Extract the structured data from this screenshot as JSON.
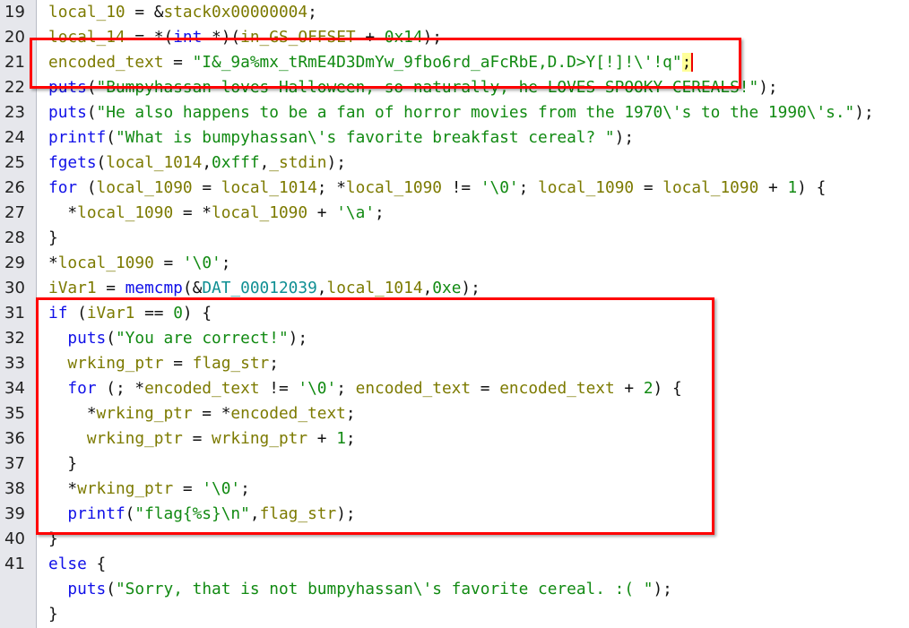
{
  "highlight_color": "#ff0000",
  "lines": [
    {
      "num": "19",
      "tokens": [
        {
          "c": "v",
          "t": "local_10"
        },
        {
          "c": "p",
          "t": " = &"
        },
        {
          "c": "v",
          "t": "stack0x00000004"
        },
        {
          "c": "p",
          "t": ";"
        }
      ]
    },
    {
      "num": "20",
      "tokens": [
        {
          "c": "v",
          "t": "local_14"
        },
        {
          "c": "p",
          "t": " = *("
        },
        {
          "c": "k",
          "t": "int"
        },
        {
          "c": "p",
          "t": " *)("
        },
        {
          "c": "v",
          "t": "in_GS_OFFSET"
        },
        {
          "c": "p",
          "t": " + "
        },
        {
          "c": "n",
          "t": "0x14"
        },
        {
          "c": "p",
          "t": ");"
        }
      ]
    },
    {
      "num": "21",
      "tokens": [
        {
          "c": "v",
          "t": "encoded_text"
        },
        {
          "c": "p",
          "t": " = "
        },
        {
          "c": "s",
          "t": "\"I&_9a%mx_tRmE4D3DmYw_9fbo6rd_aFcRbE,D.D>Y[!]!\\'!q\""
        },
        {
          "c": "h",
          "t": ";"
        }
      ]
    },
    {
      "num": "22",
      "tokens": [
        {
          "c": "f",
          "t": "puts"
        },
        {
          "c": "p",
          "t": "("
        },
        {
          "c": "s",
          "t": "\"Bumpyhassan loves Halloween, so naturally, he LOVES SPOOKY CEREALS!\""
        },
        {
          "c": "p",
          "t": ");"
        }
      ]
    },
    {
      "num": "23",
      "tokens": [
        {
          "c": "f",
          "t": "puts"
        },
        {
          "c": "p",
          "t": "("
        },
        {
          "c": "s",
          "t": "\"He also happens to be a fan of horror movies from the 1970\\'s to the 1990\\'s.\""
        },
        {
          "c": "p",
          "t": ");"
        }
      ]
    },
    {
      "num": "24",
      "tokens": [
        {
          "c": "f",
          "t": "printf"
        },
        {
          "c": "p",
          "t": "("
        },
        {
          "c": "s",
          "t": "\"What is bumpyhassan\\'s favorite breakfast cereal? \""
        },
        {
          "c": "p",
          "t": ");"
        }
      ]
    },
    {
      "num": "25",
      "tokens": [
        {
          "c": "f",
          "t": "fgets"
        },
        {
          "c": "p",
          "t": "("
        },
        {
          "c": "v",
          "t": "local_1014"
        },
        {
          "c": "p",
          "t": ","
        },
        {
          "c": "n",
          "t": "0xfff"
        },
        {
          "c": "p",
          "t": ","
        },
        {
          "c": "v",
          "t": "_stdin"
        },
        {
          "c": "p",
          "t": ");"
        }
      ]
    },
    {
      "num": "26",
      "tokens": [
        {
          "c": "k",
          "t": "for"
        },
        {
          "c": "p",
          "t": " ("
        },
        {
          "c": "v",
          "t": "local_1090"
        },
        {
          "c": "p",
          "t": " = "
        },
        {
          "c": "v",
          "t": "local_1014"
        },
        {
          "c": "p",
          "t": "; *"
        },
        {
          "c": "v",
          "t": "local_1090"
        },
        {
          "c": "p",
          "t": " != "
        },
        {
          "c": "s",
          "t": "'\\0'"
        },
        {
          "c": "p",
          "t": "; "
        },
        {
          "c": "v",
          "t": "local_1090"
        },
        {
          "c": "p",
          "t": " = "
        },
        {
          "c": "v",
          "t": "local_1090"
        },
        {
          "c": "p",
          "t": " + "
        },
        {
          "c": "n",
          "t": "1"
        },
        {
          "c": "p",
          "t": ") {"
        }
      ]
    },
    {
      "num": "27",
      "tokens": [
        {
          "c": "p",
          "t": "  *"
        },
        {
          "c": "v",
          "t": "local_1090"
        },
        {
          "c": "p",
          "t": " = *"
        },
        {
          "c": "v",
          "t": "local_1090"
        },
        {
          "c": "p",
          "t": " + "
        },
        {
          "c": "s",
          "t": "'\\a'"
        },
        {
          "c": "p",
          "t": ";"
        }
      ]
    },
    {
      "num": "28",
      "tokens": [
        {
          "c": "p",
          "t": "}"
        }
      ]
    },
    {
      "num": "29",
      "tokens": [
        {
          "c": "p",
          "t": "*"
        },
        {
          "c": "v",
          "t": "local_1090"
        },
        {
          "c": "p",
          "t": " = "
        },
        {
          "c": "s",
          "t": "'\\0'"
        },
        {
          "c": "p",
          "t": ";"
        }
      ]
    },
    {
      "num": "30",
      "tokens": [
        {
          "c": "v",
          "t": "iVar1"
        },
        {
          "c": "p",
          "t": " = "
        },
        {
          "c": "f",
          "t": "memcmp"
        },
        {
          "c": "p",
          "t": "(&"
        },
        {
          "c": "d",
          "t": "DAT_00012039"
        },
        {
          "c": "p",
          "t": ","
        },
        {
          "c": "v",
          "t": "local_1014"
        },
        {
          "c": "p",
          "t": ","
        },
        {
          "c": "n",
          "t": "0xe"
        },
        {
          "c": "p",
          "t": ");"
        }
      ]
    },
    {
      "num": "31",
      "tokens": [
        {
          "c": "k",
          "t": "if"
        },
        {
          "c": "p",
          "t": " ("
        },
        {
          "c": "v",
          "t": "iVar1"
        },
        {
          "c": "p",
          "t": " == "
        },
        {
          "c": "n",
          "t": "0"
        },
        {
          "c": "p",
          "t": ") {"
        }
      ]
    },
    {
      "num": "32",
      "tokens": [
        {
          "c": "p",
          "t": "  "
        },
        {
          "c": "f",
          "t": "puts"
        },
        {
          "c": "p",
          "t": "("
        },
        {
          "c": "s",
          "t": "\"You are correct!\""
        },
        {
          "c": "p",
          "t": ");"
        }
      ]
    },
    {
      "num": "33",
      "tokens": [
        {
          "c": "p",
          "t": "  "
        },
        {
          "c": "v",
          "t": "wrking_ptr"
        },
        {
          "c": "p",
          "t": " = "
        },
        {
          "c": "v",
          "t": "flag_str"
        },
        {
          "c": "p",
          "t": ";"
        }
      ]
    },
    {
      "num": "34",
      "tokens": [
        {
          "c": "p",
          "t": "  "
        },
        {
          "c": "k",
          "t": "for"
        },
        {
          "c": "p",
          "t": " (; *"
        },
        {
          "c": "v",
          "t": "encoded_text"
        },
        {
          "c": "p",
          "t": " != "
        },
        {
          "c": "s",
          "t": "'\\0'"
        },
        {
          "c": "p",
          "t": "; "
        },
        {
          "c": "v",
          "t": "encoded_text"
        },
        {
          "c": "p",
          "t": " = "
        },
        {
          "c": "v",
          "t": "encoded_text"
        },
        {
          "c": "p",
          "t": " + "
        },
        {
          "c": "n",
          "t": "2"
        },
        {
          "c": "p",
          "t": ") {"
        }
      ]
    },
    {
      "num": "35",
      "tokens": [
        {
          "c": "p",
          "t": "    *"
        },
        {
          "c": "v",
          "t": "wrking_ptr"
        },
        {
          "c": "p",
          "t": " = *"
        },
        {
          "c": "v",
          "t": "encoded_text"
        },
        {
          "c": "p",
          "t": ";"
        }
      ]
    },
    {
      "num": "36",
      "tokens": [
        {
          "c": "p",
          "t": "    "
        },
        {
          "c": "v",
          "t": "wrking_ptr"
        },
        {
          "c": "p",
          "t": " = "
        },
        {
          "c": "v",
          "t": "wrking_ptr"
        },
        {
          "c": "p",
          "t": " + "
        },
        {
          "c": "n",
          "t": "1"
        },
        {
          "c": "p",
          "t": ";"
        }
      ]
    },
    {
      "num": "37",
      "tokens": [
        {
          "c": "p",
          "t": "  }"
        }
      ]
    },
    {
      "num": "38",
      "tokens": [
        {
          "c": "p",
          "t": "  *"
        },
        {
          "c": "v",
          "t": "wrking_ptr"
        },
        {
          "c": "p",
          "t": " = "
        },
        {
          "c": "s",
          "t": "'\\0'"
        },
        {
          "c": "p",
          "t": ";"
        }
      ]
    },
    {
      "num": "39",
      "tokens": [
        {
          "c": "p",
          "t": "  "
        },
        {
          "c": "f",
          "t": "printf"
        },
        {
          "c": "p",
          "t": "("
        },
        {
          "c": "s",
          "t": "\"flag{%s}\\n\""
        },
        {
          "c": "p",
          "t": ","
        },
        {
          "c": "v",
          "t": "flag_str"
        },
        {
          "c": "p",
          "t": ");"
        }
      ]
    },
    {
      "num": "40",
      "tokens": [
        {
          "c": "p",
          "t": "}"
        }
      ]
    },
    {
      "num": "41",
      "tokens": [
        {
          "c": "k",
          "t": "else"
        },
        {
          "c": "p",
          "t": " {"
        }
      ]
    },
    {
      "num": "",
      "tokens": [
        {
          "c": "p",
          "t": "  "
        },
        {
          "c": "f",
          "t": "puts"
        },
        {
          "c": "p",
          "t": "("
        },
        {
          "c": "s",
          "t": "\"Sorry, that is not bumpyhassan\\'s favorite cereal. :( \""
        },
        {
          "c": "p",
          "t": ");"
        }
      ]
    },
    {
      "num": "",
      "tokens": [
        {
          "c": "p",
          "t": "}"
        }
      ]
    }
  ]
}
